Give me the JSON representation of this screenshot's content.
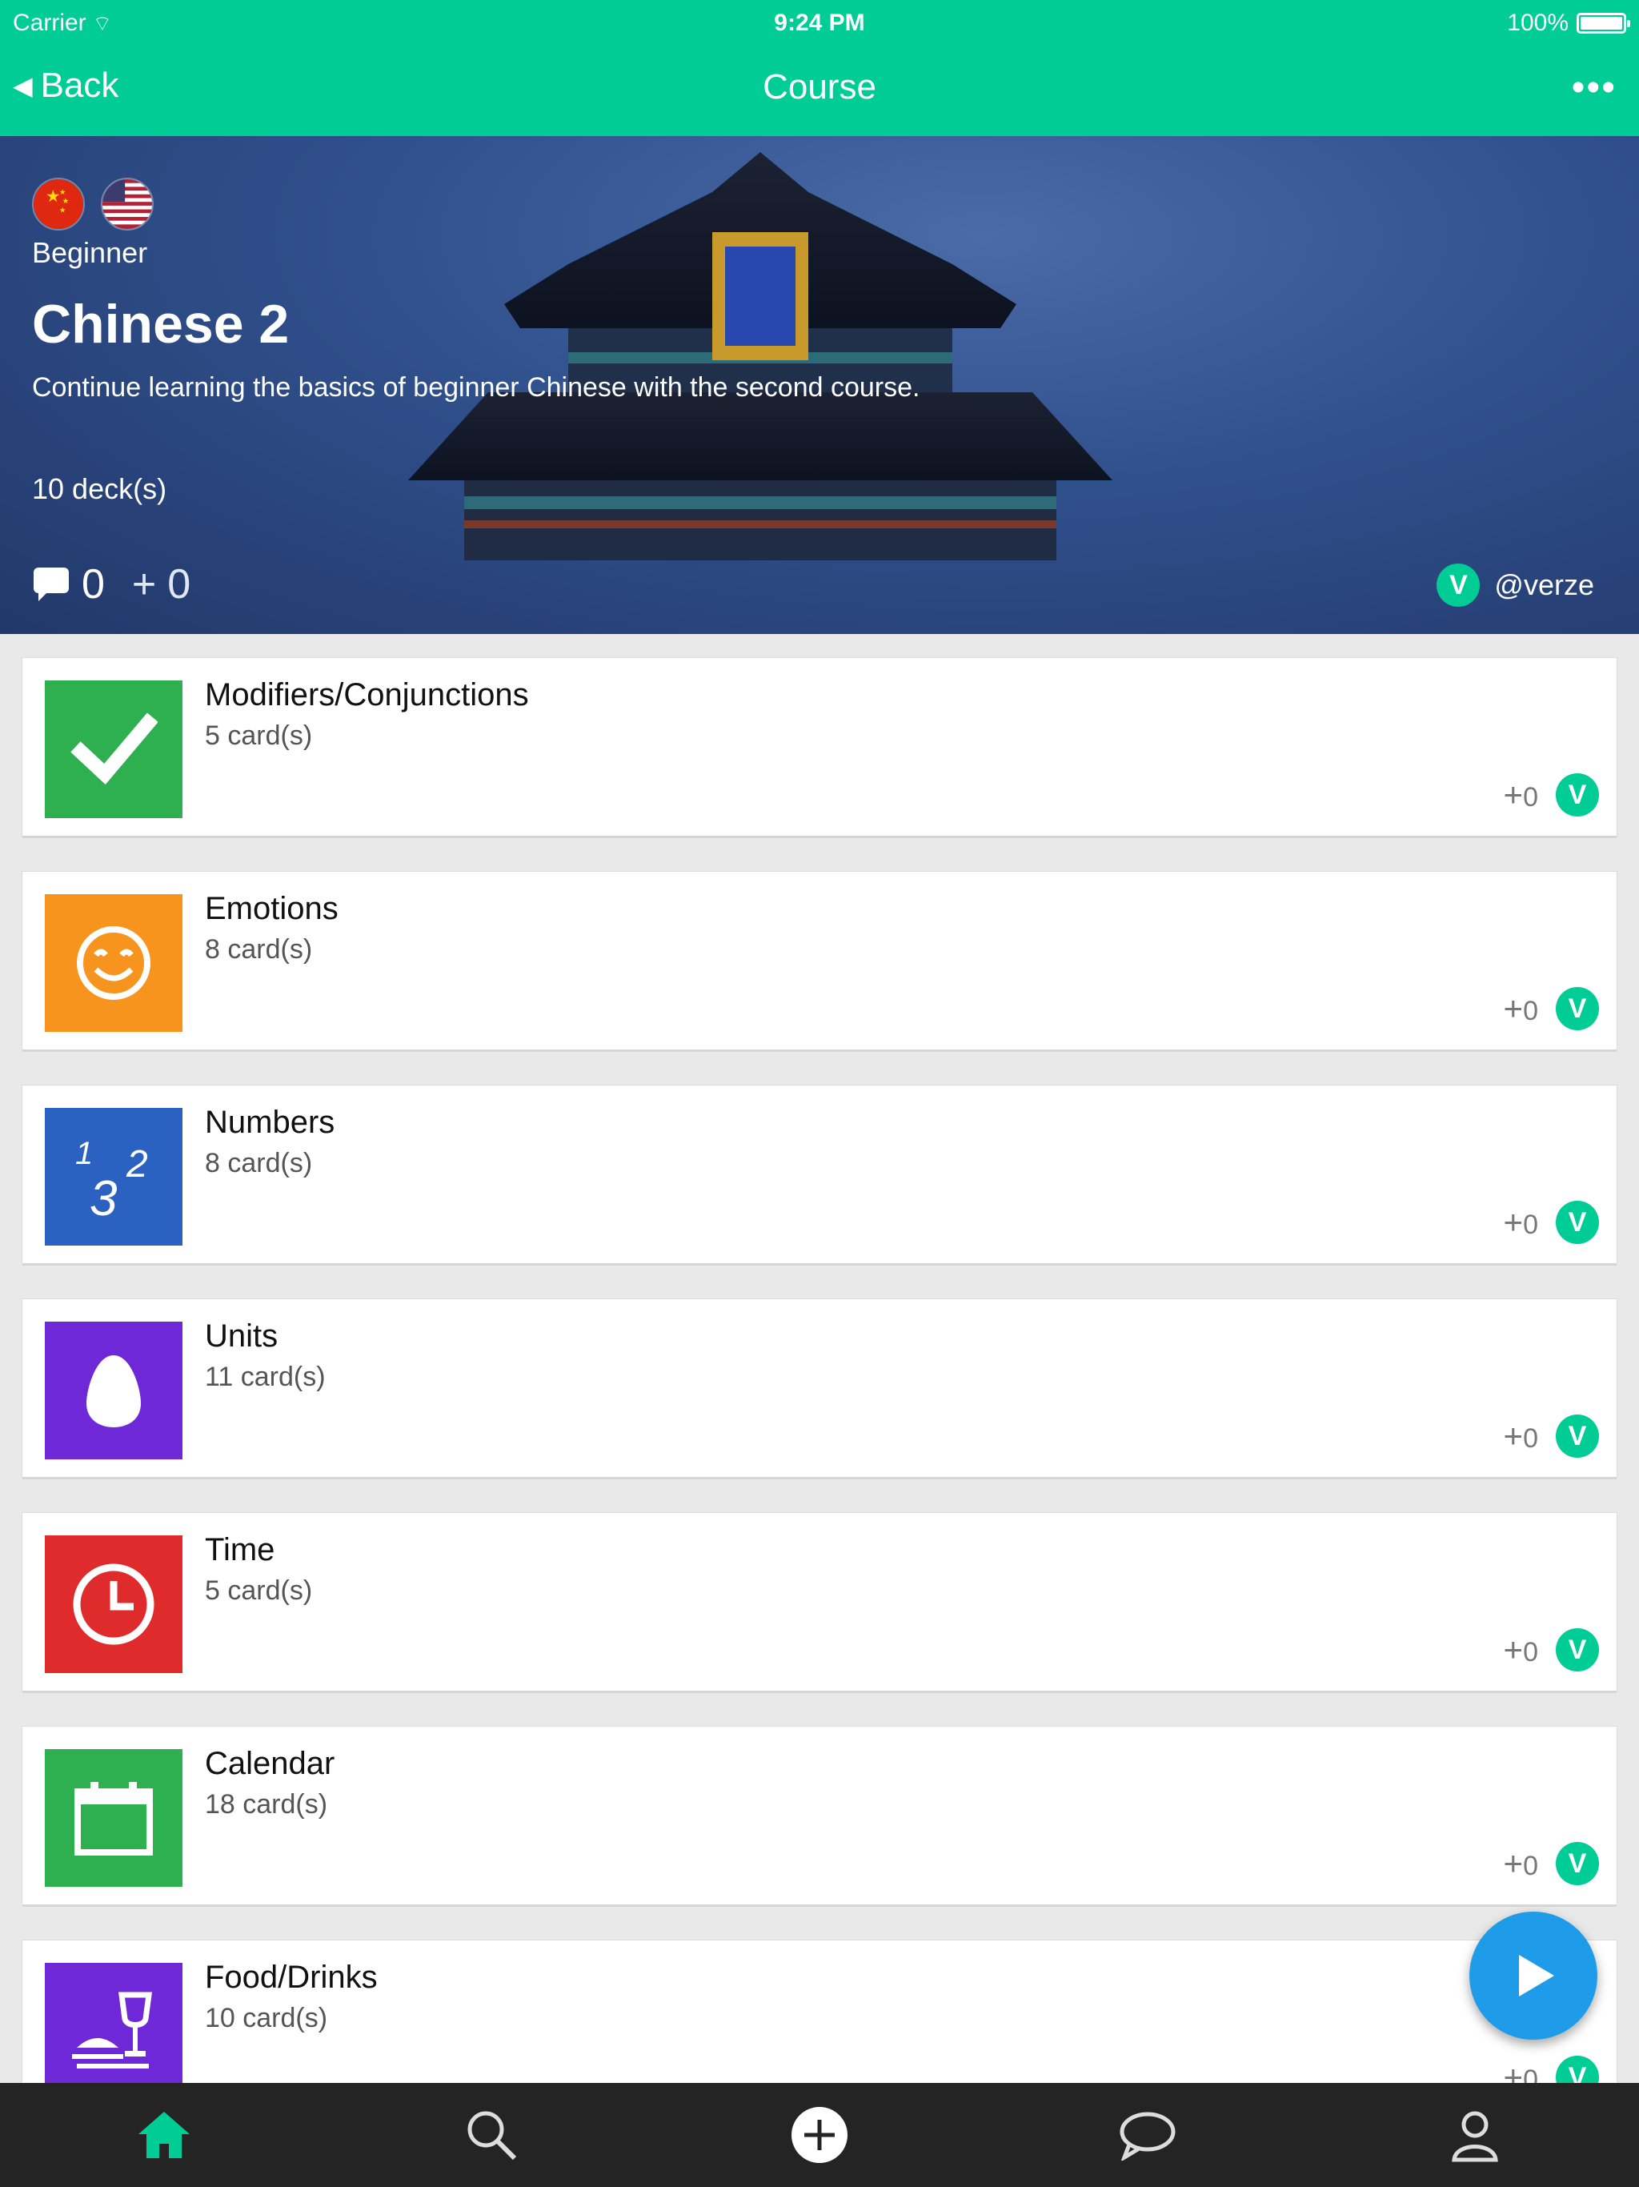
{
  "status_bar": {
    "carrier": "Carrier",
    "time": "9:24 PM",
    "battery": "100%"
  },
  "nav": {
    "back_label": "Back",
    "title": "Course",
    "more_label": "•••"
  },
  "course": {
    "level": "Beginner",
    "title": "Chinese 2",
    "description": "Continue learning the basics of beginner Chinese with the second course.",
    "decks": "10 deck(s)",
    "comments": "0",
    "adds": "0",
    "owner": "@verze",
    "owner_badge": "V"
  },
  "decks": [
    {
      "name": "Modifiers/Conjunctions",
      "count": "5 card(s)",
      "adds": "0",
      "badge": "V",
      "color": "#2eb050",
      "icon": "checkmark-icon"
    },
    {
      "name": "Emotions",
      "count": "8 card(s)",
      "adds": "0",
      "badge": "V",
      "color": "#f7941d",
      "icon": "smiley-icon"
    },
    {
      "name": "Numbers",
      "count": "8 card(s)",
      "adds": "0",
      "badge": "V",
      "color": "#2b62c2",
      "icon": "numbers-icon"
    },
    {
      "name": "Units",
      "count": "11 card(s)",
      "adds": "0",
      "badge": "V",
      "color": "#6f28d8",
      "icon": "egg-icon"
    },
    {
      "name": "Time",
      "count": "5 card(s)",
      "adds": "0",
      "badge": "V",
      "color": "#df2b2b",
      "icon": "clock-icon"
    },
    {
      "name": "Calendar",
      "count": "18 card(s)",
      "adds": "0",
      "badge": "V",
      "color": "#2eb050",
      "icon": "calendar-icon"
    },
    {
      "name": "Food/Drinks",
      "count": "10 card(s)",
      "adds": "0",
      "badge": "V",
      "color": "#6f28d8",
      "icon": "food-drinks-icon"
    }
  ],
  "colors": {
    "brand": "#00cc96",
    "fab": "#1e9cea",
    "tabbar": "#242424"
  }
}
